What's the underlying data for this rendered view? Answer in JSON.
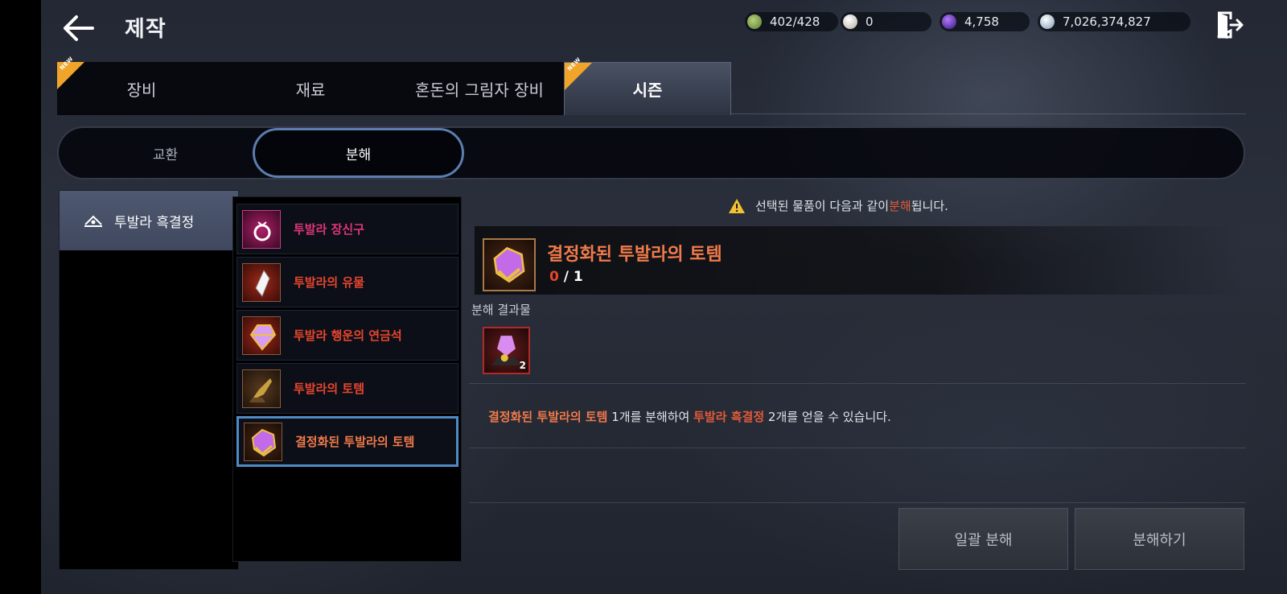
{
  "header": {
    "title": "제작",
    "currencies": [
      {
        "icon": "stamina-icon",
        "value": "402/428",
        "color": "#7fa04a"
      },
      {
        "icon": "pearl-icon",
        "value": "0",
        "color": "#d8cfc4"
      },
      {
        "icon": "dark-orb-icon",
        "value": "4,758",
        "color": "#6a2fb8"
      },
      {
        "icon": "silver-coin-icon",
        "value": "7,026,374,827",
        "color": "#c8d8e8"
      }
    ]
  },
  "tabs": [
    {
      "label": "장비",
      "badge": "NEW"
    },
    {
      "label": "재료",
      "badge": ""
    },
    {
      "label": "혼돈의 그림자 장비",
      "badge": ""
    },
    {
      "label": "시즌",
      "badge": "NEW",
      "active": true
    }
  ],
  "subtabs": [
    {
      "label": "교환"
    },
    {
      "label": "분해",
      "active": true
    }
  ],
  "category": {
    "label": "투발라 흑결정",
    "icon": "tuvala-emblem-icon"
  },
  "items": [
    {
      "name": "투발라 장신구",
      "color": "#e0357a",
      "icon": "ring-icon"
    },
    {
      "name": "투발라의 유물",
      "color": "#e8452e",
      "icon": "crystal-relic-icon"
    },
    {
      "name": "투발라 행운의 연금석",
      "color": "#e8452e",
      "icon": "alchemy-stone-icon"
    },
    {
      "name": "투발라의 토템",
      "color": "#e8452e",
      "icon": "totem-icon"
    },
    {
      "name": "결정화된 투발라의 토템",
      "color": "#f07a4a",
      "icon": "crystallized-totem-icon",
      "selected": true
    }
  ],
  "detail": {
    "warning_pre": "선택된 물품이 다음과 같이 ",
    "warning_hl": "분해",
    "warning_post": "됩니다.",
    "target_name": "결정화된 투발라의 토템",
    "target_current": "0",
    "target_total": " / 1",
    "result_label": "분해 결과물",
    "result_qty": "2",
    "desc_item": "결정화된 투발라의 토템",
    "desc_mid": " 1개를 분해하여 ",
    "desc_result": "투발라 흑결정",
    "desc_end": " 2개를 얻을 수 있습니다."
  },
  "buttons": {
    "bulk": "일괄 분해",
    "disassemble": "분해하기"
  }
}
